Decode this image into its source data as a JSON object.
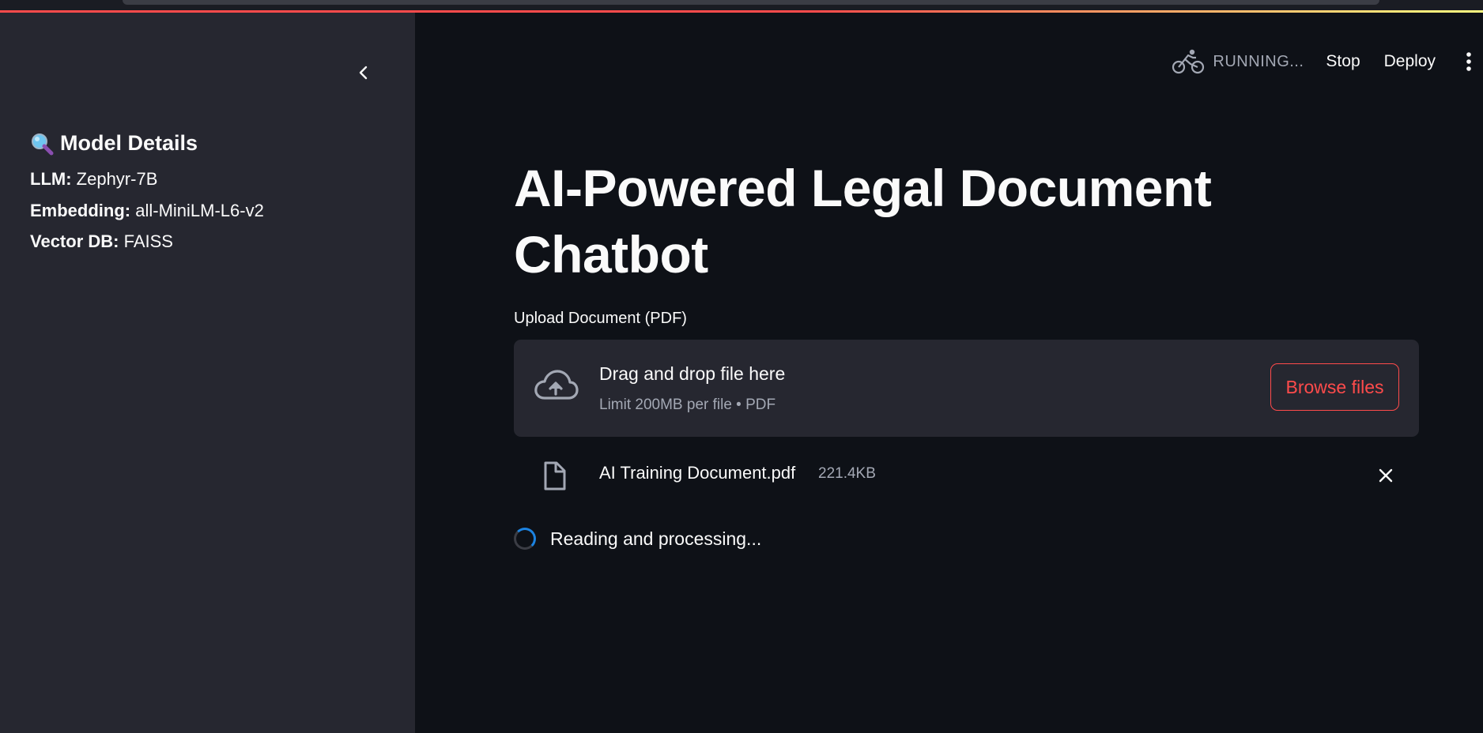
{
  "sidebar": {
    "title": "Model Details",
    "title_icon": "magnifier-icon",
    "details": [
      {
        "key": "LLM:",
        "value": "Zephyr-7B"
      },
      {
        "key": "Embedding:",
        "value": "all-MiniLM-L6-v2"
      },
      {
        "key": "Vector DB:",
        "value": "FAISS"
      }
    ]
  },
  "toolbar": {
    "status": "RUNNING...",
    "stop_label": "Stop",
    "deploy_label": "Deploy"
  },
  "main": {
    "title": "AI-Powered Legal Document Chatbot",
    "upload": {
      "label": "Upload Document (PDF)",
      "drop_text": "Drag and drop file here",
      "limit_text": "Limit 200MB per file • PDF",
      "browse_label": "Browse files"
    },
    "file": {
      "name": "AI Training Document.pdf",
      "size": "221.4KB"
    },
    "spinner_text": "Reading and processing..."
  },
  "colors": {
    "accent": "#ff4b4b",
    "background": "#0e1117",
    "sidebar": "#262730",
    "spinner": "#1c83e1"
  }
}
